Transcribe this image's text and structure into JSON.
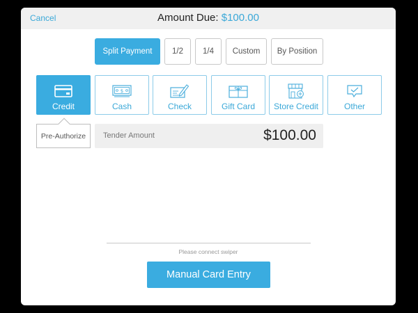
{
  "header": {
    "cancel_label": "Cancel",
    "title_prefix": "Amount Due:",
    "title_amount": "$100.00"
  },
  "split_options": [
    {
      "label": "Split Payment",
      "active": true
    },
    {
      "label": "1/2"
    },
    {
      "label": "1/4"
    },
    {
      "label": "Custom"
    },
    {
      "label": "By Position"
    }
  ],
  "tender_types": [
    {
      "label": "Credit",
      "icon": "credit-card-icon",
      "active": true
    },
    {
      "label": "Cash",
      "icon": "cash-icon"
    },
    {
      "label": "Check",
      "icon": "check-pen-icon"
    },
    {
      "label": "Gift Card",
      "icon": "gift-card-icon"
    },
    {
      "label": "Store Credit",
      "icon": "store-icon"
    },
    {
      "label": "Other",
      "icon": "chat-check-icon"
    }
  ],
  "preauthorize_label": "Pre-Authorize",
  "tender_amount": {
    "label": "Tender Amount",
    "value": "$100.00"
  },
  "swiper_message": "Please connect swiper",
  "manual_entry_label": "Manual Card Entry",
  "colors": {
    "accent": "#3aace0",
    "accent_text": "#3aa8d8",
    "header_bg": "#f0f0f0",
    "field_bg": "#efefef"
  }
}
